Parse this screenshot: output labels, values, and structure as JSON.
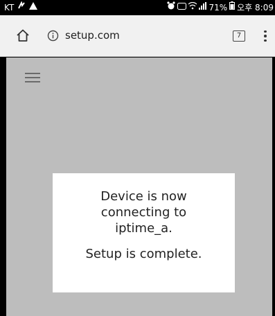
{
  "status_bar": {
    "carrier": "KT",
    "right_text": "71%",
    "time": "오후 8:09"
  },
  "browser": {
    "url": "setup.com",
    "tab_count": "7"
  },
  "dialog": {
    "message_line1": "Device is now",
    "message_line2": "connecting to",
    "message_line3": "iptime_a.",
    "status": "Setup is complete."
  }
}
